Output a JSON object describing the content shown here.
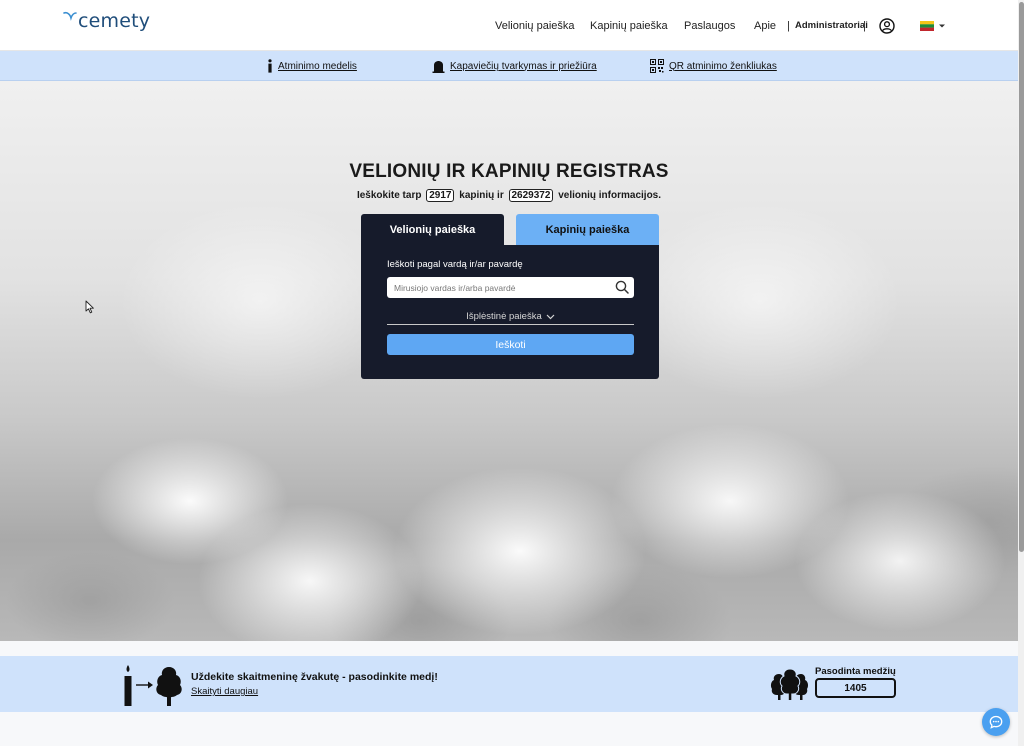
{
  "brand": {
    "logo_text": "cemety"
  },
  "nav": {
    "items": [
      "Velionių paieška",
      "Kapinių paieška",
      "Paslaugos",
      "Apie"
    ],
    "admin_label": "Administratoriai",
    "separator": "|",
    "language_icon": "lithuanian-flag-icon"
  },
  "subnav": {
    "items": [
      {
        "label": "Atminimo medelis",
        "icon": "info-icon"
      },
      {
        "label": "Kapaviečių tvarkymas ir priežiūra",
        "icon": "gravestone-icon"
      },
      {
        "label": "QR atminimo ženkliukas",
        "icon": "qr-code-icon"
      }
    ]
  },
  "hero": {
    "title": "VELIONIŲ IR KAPINIŲ REGISTRAS",
    "subtitle_prefix": "Ieškokite tarp",
    "cemeteries_count": "2917",
    "subtitle_middle": "kapinių ir",
    "deceased_count": "2629372",
    "subtitle_suffix": "velionių informacijos."
  },
  "search": {
    "tabs": [
      {
        "label": "Velionių paieška",
        "active": true
      },
      {
        "label": "Kapinių paieška",
        "active": false
      }
    ],
    "field_label": "Ieškoti pagal vardą ir/ar pavardę",
    "placeholder": "Mirusiojo vardas ir/arba pavardė",
    "value": "",
    "advanced_label": "Išplėstinė paieška",
    "submit_label": "Ieškoti"
  },
  "promo": {
    "title": "Uždekite skaitmeninę žvakutę - pasodinkite medį!",
    "link": "Skaityti daugiau",
    "trees_label": "Pasodinta medžių",
    "trees_count": "1405"
  },
  "colors": {
    "accent": "#5ea7f3",
    "panel": "#161b2b",
    "light_band": "#cfe2fb"
  }
}
